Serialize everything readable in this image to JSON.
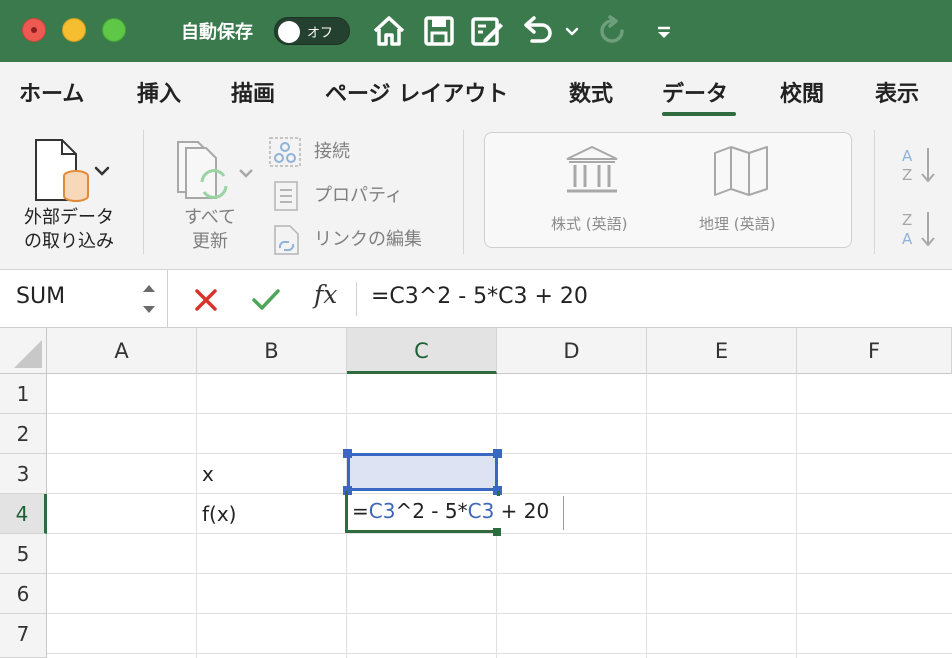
{
  "titlebar": {
    "autosave_label": "自動保存",
    "autosave_state": "オフ",
    "icons": [
      "home-icon",
      "save-icon",
      "edit-document-icon",
      "undo-icon",
      "redo-icon",
      "customize-toolbar-icon"
    ]
  },
  "tabs": [
    {
      "label": "ホーム"
    },
    {
      "label": "挿入"
    },
    {
      "label": "描画"
    },
    {
      "label": "ページ レイアウト"
    },
    {
      "label": "数式"
    },
    {
      "label": "データ",
      "active": true
    },
    {
      "label": "校閲"
    },
    {
      "label": "表示"
    }
  ],
  "ribbon": {
    "external_data_line1": "外部データ",
    "external_data_line2": "の取り込み",
    "refresh_line1": "すべて",
    "refresh_line2": "更新",
    "connections": "接続",
    "properties": "プロパティ",
    "edit_links": "リンクの編集",
    "stocks": "株式 (英語)",
    "geography": "地理 (英語)",
    "sort_az": "AZ",
    "sort_za": "ZA"
  },
  "formula_bar": {
    "name_box": "SUM",
    "fx_label": "fx",
    "formula": "=C3^2 - 5*C3 + 20"
  },
  "grid": {
    "columns": [
      "A",
      "B",
      "C",
      "D",
      "E",
      "F"
    ],
    "rows": [
      "1",
      "2",
      "3",
      "4",
      "5",
      "6",
      "7"
    ],
    "active_column": "C",
    "active_row": "4",
    "cells": {
      "B3": "x",
      "B4": "f(x)"
    },
    "edit": {
      "eq": "=",
      "ref1": "C3",
      "mid": "^2 - 5*",
      "ref2": "C3",
      "tail": " + 20"
    }
  },
  "colors": {
    "title_green": "#3a7a4d",
    "accent_green": "#2f6b3f",
    "reference_blue": "#3a66c4",
    "cancel_red": "#d9342b",
    "confirm_green": "#4fa65a"
  }
}
